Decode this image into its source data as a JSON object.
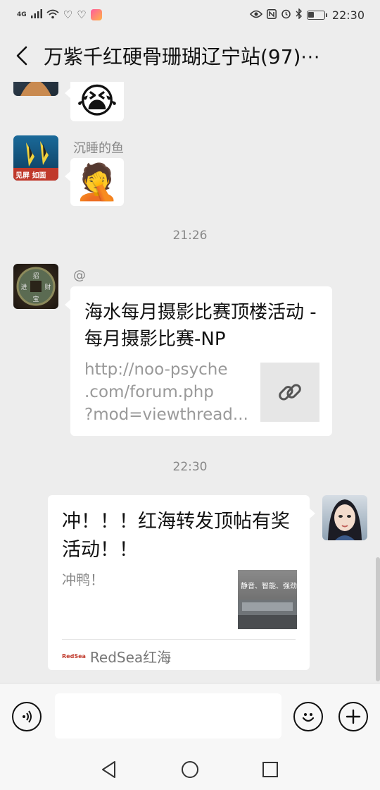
{
  "status_bar": {
    "left_icons": [
      "network-4g-icon",
      "signal-icon",
      "wifi-icon",
      "heart-outline-icon",
      "heart-outline-icon",
      "app-badge-icon"
    ],
    "right_icons": [
      "eye-icon",
      "nfc-icon",
      "alarm-icon",
      "bluetooth-icon",
      "battery-icon"
    ],
    "network": "4G",
    "battery_level": 0.4,
    "time": "22:30"
  },
  "header": {
    "title": "万紫千红硬骨珊瑚辽宁站(97)",
    "more": "···"
  },
  "messages": [
    {
      "type": "emoji",
      "emoji": "😭",
      "partial": true
    },
    {
      "type": "emoji",
      "sender": "沉睡的鱼",
      "emoji": "🤦",
      "avatar_text": "见屏 如面"
    },
    {
      "type": "time",
      "text": "21:26"
    },
    {
      "type": "link",
      "sender": "@",
      "title": "海水每月摄影比赛顶楼活动 - 每月摄影比赛-NP",
      "url_lines": [
        "http://noo-psyche",
        ".com/forum.php",
        "?mod=viewthread..."
      ]
    },
    {
      "type": "time",
      "text": "22:30"
    },
    {
      "type": "share",
      "title": "冲！！！红海转发顶帖有奖活动！！",
      "desc": "冲鸭！",
      "thumb_text": "静音、智能、强劲",
      "source": "RedSea红海"
    }
  ],
  "input": {
    "placeholder": ""
  },
  "nav": {
    "back": "◁",
    "home": "○",
    "recent": "□"
  },
  "colors": {
    "background": "#ededed",
    "bubble": "#ffffff",
    "meta_text": "#888888"
  }
}
